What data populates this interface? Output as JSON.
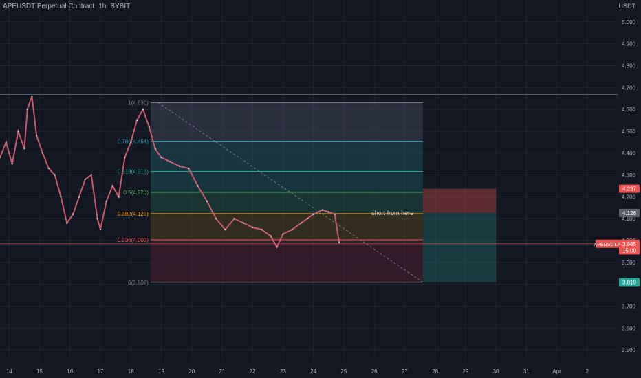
{
  "header": {
    "symbol": "APEUSDT Perpetual Contract",
    "interval": "1h",
    "exchange": "BYBIT"
  },
  "currency": "USDT",
  "colors": {
    "bg": "#131722",
    "up": "#26a69a",
    "down": "#ef5350",
    "grid": "#1f2433"
  },
  "chart_data": {
    "type": "line",
    "title": "APEUSDT Perpetual Contract, 1h, BYBIT",
    "ylim": [
      3.45,
      5.1
    ],
    "y_ticks": [
      "5.000",
      "4.900",
      "4.800",
      "4.700",
      "4.600",
      "4.500",
      "4.400",
      "4.300",
      "4.200",
      "4.100",
      "4.000",
      "3.900",
      "3.800",
      "3.700",
      "3.600",
      "3.500"
    ],
    "x_ticks": [
      "14",
      "15",
      "16",
      "17",
      "18",
      "19",
      "20",
      "21",
      "22",
      "23",
      "24",
      "25",
      "26",
      "27",
      "28",
      "29",
      "30",
      "31",
      "Apr",
      "2"
    ],
    "x_tick_values": [
      14,
      15,
      16,
      17,
      18,
      19,
      20,
      21,
      22,
      23,
      24,
      25,
      26,
      27,
      28,
      29,
      30,
      31,
      32,
      33
    ],
    "xlim": [
      13.7,
      34.0
    ],
    "series": [
      {
        "values": [
          [
            13.7,
            4.38
          ],
          [
            13.9,
            4.45
          ],
          [
            14.1,
            4.35
          ],
          [
            14.3,
            4.5
          ],
          [
            14.5,
            4.42
          ],
          [
            14.6,
            4.6
          ],
          [
            14.75,
            4.66
          ],
          [
            14.9,
            4.48
          ],
          [
            15.1,
            4.4
          ],
          [
            15.3,
            4.33
          ],
          [
            15.5,
            4.3
          ],
          [
            15.7,
            4.2
          ],
          [
            15.9,
            4.08
          ],
          [
            16.1,
            4.12
          ],
          [
            16.3,
            4.2
          ],
          [
            16.5,
            4.28
          ],
          [
            16.7,
            4.3
          ],
          [
            16.9,
            4.1
          ],
          [
            17.0,
            4.05
          ],
          [
            17.2,
            4.18
          ],
          [
            17.4,
            4.25
          ],
          [
            17.6,
            4.2
          ],
          [
            17.8,
            4.38
          ],
          [
            18.0,
            4.45
          ],
          [
            18.2,
            4.55
          ],
          [
            18.4,
            4.6
          ],
          [
            18.6,
            4.52
          ],
          [
            18.8,
            4.42
          ],
          [
            19.0,
            4.38
          ],
          [
            19.3,
            4.36
          ],
          [
            19.6,
            4.34
          ],
          [
            19.9,
            4.33
          ],
          [
            20.2,
            4.25
          ],
          [
            20.5,
            4.18
          ],
          [
            20.8,
            4.1
          ],
          [
            21.1,
            4.05
          ],
          [
            21.4,
            4.1
          ],
          [
            21.7,
            4.08
          ],
          [
            22.0,
            4.06
          ],
          [
            22.3,
            4.05
          ],
          [
            22.6,
            4.02
          ],
          [
            22.8,
            3.97
          ],
          [
            23.0,
            4.03
          ],
          [
            23.3,
            4.05
          ],
          [
            23.6,
            4.08
          ],
          [
            23.8,
            4.1
          ],
          [
            24.0,
            4.12
          ],
          [
            24.3,
            4.14
          ],
          [
            24.5,
            4.13
          ],
          [
            24.7,
            4.12
          ],
          [
            24.85,
            3.99
          ]
        ]
      }
    ],
    "fib_levels": [
      {
        "ratio": "1",
        "value": 4.63,
        "label": "1(4.630)"
      },
      {
        "ratio": "0.786",
        "value": 4.454,
        "label": "0.786(4.454)"
      },
      {
        "ratio": "0.618",
        "value": 4.316,
        "label": "0.618(4.316)"
      },
      {
        "ratio": "0.5",
        "value": 4.22,
        "label": "0.5(4.220)"
      },
      {
        "ratio": "0.382",
        "value": 4.123,
        "label": "0.382(4.123)"
      },
      {
        "ratio": "0.236",
        "value": 4.003,
        "label": "0.236(4.003)"
      },
      {
        "ratio": "0",
        "value": 3.809,
        "label": "0(3.809)"
      }
    ],
    "fib_x_range": [
      18.65,
      27.6
    ],
    "short_position": {
      "from_x": 27.6,
      "to_x": 30.0,
      "entry": 4.126,
      "stop": 4.237,
      "target": 3.81
    },
    "annotation": "short from here",
    "price_labels": [
      {
        "text": "4.237",
        "value": 4.237,
        "color": "#ef5350"
      },
      {
        "text": "4.126",
        "value": 4.126,
        "color": "#5d606b"
      },
      {
        "text": "3.985",
        "value": 3.985,
        "color": "#ef5350"
      },
      {
        "text": "15:00",
        "value": 3.955,
        "color": "#ef5350"
      },
      {
        "text": "3.810",
        "value": 3.81,
        "color": "#26a69a"
      }
    ],
    "current_label": "APEUSDT.P",
    "horizontal_line": 4.668
  }
}
